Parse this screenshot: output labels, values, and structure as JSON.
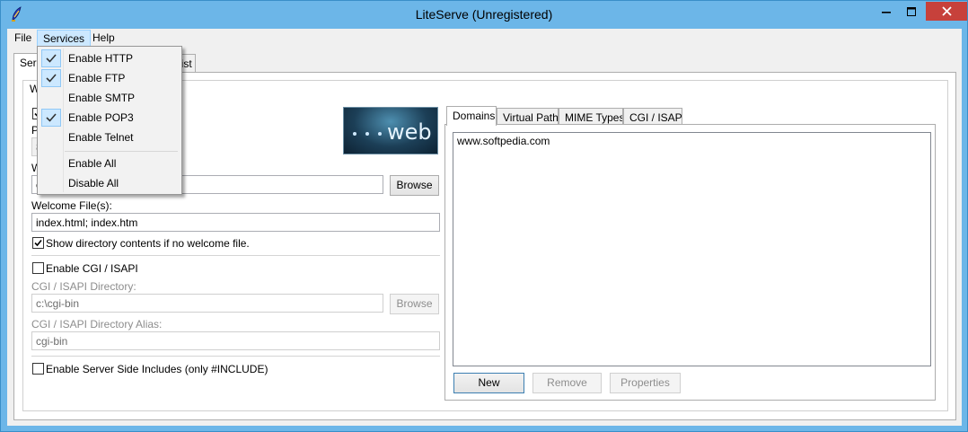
{
  "window": {
    "title": "LiteServe (Unregistered)",
    "icons": {
      "app": "feather-app-icon",
      "minimize": "minimize-icon",
      "maximize": "maximize-icon",
      "close": "close-icon"
    }
  },
  "menubar": {
    "file": "File",
    "services": "Services",
    "help": "Help"
  },
  "services_menu": {
    "items": [
      {
        "label": "Enable HTTP",
        "checked": true
      },
      {
        "label": "Enable FTP",
        "checked": true
      },
      {
        "label": "Enable SMTP",
        "checked": false
      },
      {
        "label": "Enable POP3",
        "checked": true
      },
      {
        "label": "Enable Telnet",
        "checked": false
      },
      {
        "label": "Enable All",
        "checked": false
      },
      {
        "label": "Disable All",
        "checked": false
      }
    ]
  },
  "main_tabs": {
    "services_partial": "Ser",
    "list_partial": "list"
  },
  "web_tab": {
    "group_label_partial": "W",
    "partial_labels": {
      "port": "P",
      "port_value": "8",
      "webroot": "W",
      "webroot_value": "c"
    },
    "logo_text": "web",
    "browse_label": "Browse",
    "welcome_label": "Welcome File(s):",
    "welcome_value": "index.html; index.htm",
    "show_dir_label": "Show directory contents if no welcome file.",
    "show_dir_checked": true,
    "enable_cgi_label": "Enable CGI / ISAPI",
    "enable_cgi_checked": false,
    "cgi_dir_label": "CGI / ISAPI Directory:",
    "cgi_dir_value": "c:\\cgi-bin",
    "cgi_browse_label": "Browse",
    "cgi_alias_label": "CGI / ISAPI Directory Alias:",
    "cgi_alias_value": "cgi-bin",
    "ssi_label": "Enable Server Side Includes (only #INCLUDE)",
    "ssi_checked": false
  },
  "right_tabs": [
    "Domains",
    "Virtual Paths",
    "MIME Types",
    "CGI / ISAPI"
  ],
  "domains": [
    "www.softpedia.com"
  ],
  "domain_buttons": {
    "new": "New",
    "remove": "Remove",
    "properties": "Properties"
  },
  "colors": {
    "title_bar": "#6cb6e8",
    "close_button": "#c7413b",
    "menu_highlight": "#cce8ff",
    "face": "#f0f0f0"
  }
}
